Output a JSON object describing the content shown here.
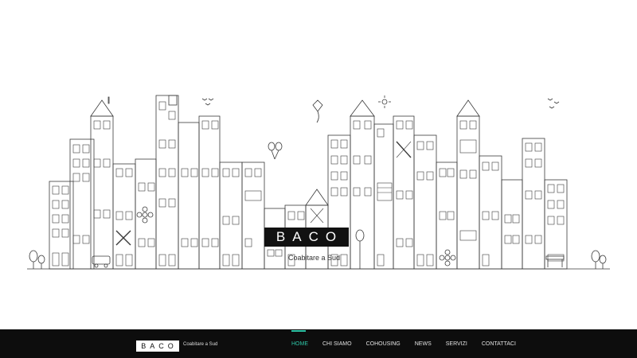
{
  "brand": {
    "name": "BACO",
    "tagline": "Coabitare a Sud"
  },
  "nav": {
    "items": [
      {
        "label": "HOME",
        "active": true
      },
      {
        "label": "CHI SIAMO",
        "active": false
      },
      {
        "label": "COHOUSING",
        "active": false
      },
      {
        "label": "NEWS",
        "active": false
      },
      {
        "label": "SERVIZI",
        "active": false
      },
      {
        "label": "CONTATTACI",
        "active": false
      }
    ]
  },
  "colors": {
    "accent": "#2ec4a6",
    "navbar_bg": "#0d0d0d",
    "line": "#333333"
  }
}
